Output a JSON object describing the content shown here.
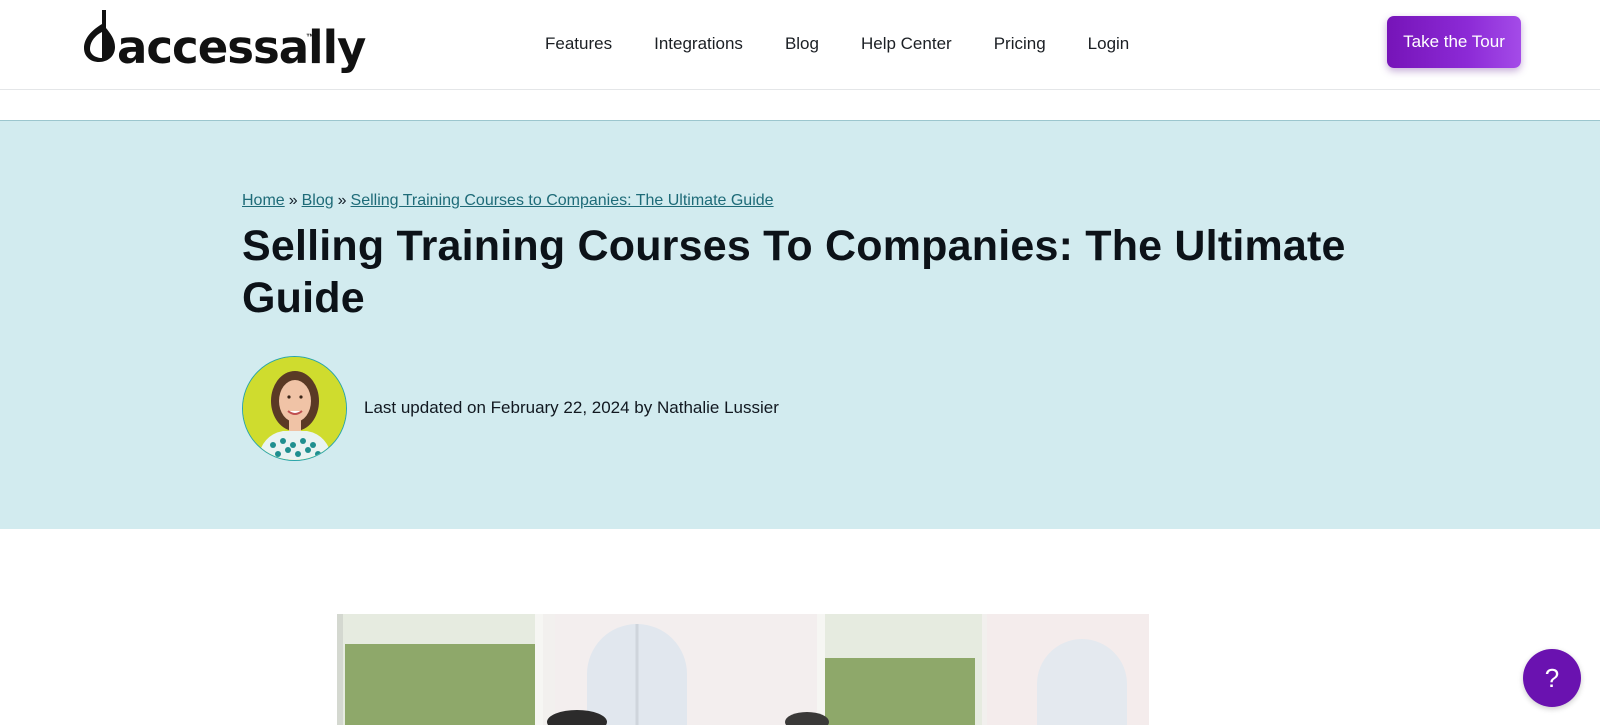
{
  "header": {
    "logo_text": "accessally",
    "logo_tm": "™",
    "nav": [
      {
        "label": "Features"
      },
      {
        "label": "Integrations"
      },
      {
        "label": "Blog"
      },
      {
        "label": "Help Center"
      },
      {
        "label": "Pricing"
      },
      {
        "label": "Login"
      }
    ],
    "cta_label": "Take the Tour"
  },
  "breadcrumb": {
    "items": [
      "Home",
      "Blog",
      "Selling Training Courses to Companies: The Ultimate Guide"
    ],
    "separator": "»"
  },
  "article": {
    "title": "Selling Training Courses To Companies: The Ultimate Guide",
    "meta": "Last updated on February 22, 2024 by Nathalie Lussier"
  },
  "help": {
    "label": "?"
  },
  "colors": {
    "hero_bg": "#d2ebef",
    "cta_purple": "#7614b8",
    "help_purple": "#6a12b0",
    "breadcrumb_link": "#1e6b78",
    "avatar_bg": "#cfdc2e"
  },
  "icons": {
    "logo_mark": "accessally-logo-mark",
    "help": "question-icon"
  }
}
